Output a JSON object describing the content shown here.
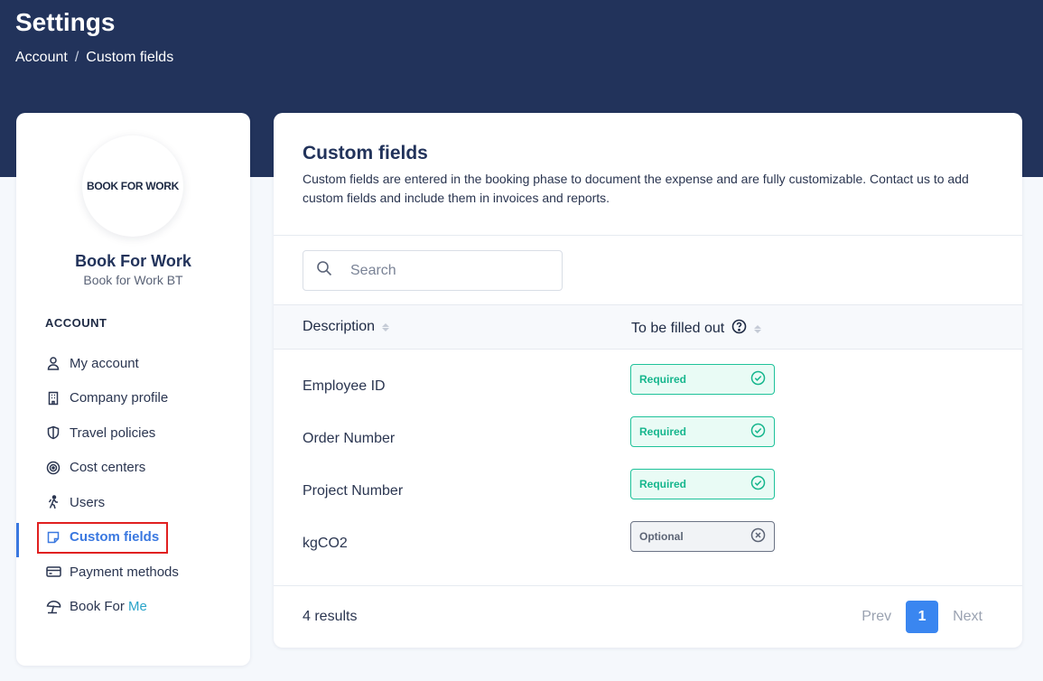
{
  "header": {
    "title": "Settings",
    "breadcrumb": {
      "root": "Account",
      "separator": "/",
      "current": "Custom fields"
    }
  },
  "sidebar": {
    "logo_text": "BOOK FOR WORK",
    "company_name": "Book For Work",
    "company_sub": "Book for Work BT",
    "section_label": "ACCOUNT",
    "items": [
      {
        "label": "My account",
        "icon": "user-icon"
      },
      {
        "label": "Company profile",
        "icon": "building-icon"
      },
      {
        "label": "Travel policies",
        "icon": "shield-icon"
      },
      {
        "label": "Cost centers",
        "icon": "target-icon"
      },
      {
        "label": "Users",
        "icon": "traveler-icon"
      },
      {
        "label": "Custom fields",
        "icon": "note-icon",
        "active": true
      },
      {
        "label": "Payment methods",
        "icon": "credit-card-icon"
      },
      {
        "label": "Book For",
        "label_accent": "Me",
        "icon": "beach-umbrella-icon"
      }
    ]
  },
  "main": {
    "title": "Custom fields",
    "description": "Custom fields are entered in the booking phase to document the expense and are fully customizable. Contact us to add custom fields and include them in invoices and reports.",
    "search": {
      "placeholder": "Search",
      "value": ""
    },
    "table": {
      "columns": [
        "Description",
        "To be filled out"
      ],
      "rows": [
        {
          "description": "Employee ID",
          "status": "Required"
        },
        {
          "description": "Order Number",
          "status": "Required"
        },
        {
          "description": "Project Number",
          "status": "Required"
        },
        {
          "description": "kgCO2",
          "status": "Optional"
        }
      ]
    },
    "footer": {
      "results": "4 results",
      "prev": "Prev",
      "page": "1",
      "next": "Next"
    }
  },
  "colors": {
    "header_bg": "#22335b",
    "accent_blue": "#3a78e0",
    "required_green": "#16b68d",
    "highlight_red": "#e02020"
  }
}
